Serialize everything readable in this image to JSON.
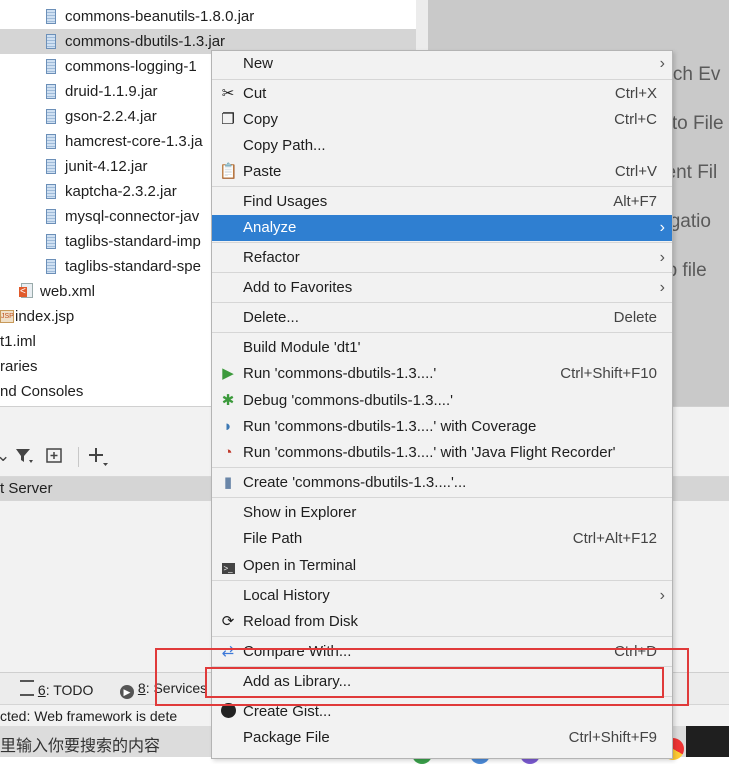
{
  "project_tree": {
    "items": [
      {
        "label": "commons-beanutils-1.8.0.jar",
        "type": "jar",
        "selected": false
      },
      {
        "label": "commons-dbutils-1.3.jar",
        "type": "jar",
        "selected": true
      },
      {
        "label": "commons-logging-1",
        "type": "jar",
        "selected": false
      },
      {
        "label": "druid-1.1.9.jar",
        "type": "jar",
        "selected": false
      },
      {
        "label": "gson-2.2.4.jar",
        "type": "jar",
        "selected": false
      },
      {
        "label": "hamcrest-core-1.3.ja",
        "type": "jar",
        "selected": false
      },
      {
        "label": "junit-4.12.jar",
        "type": "jar",
        "selected": false
      },
      {
        "label": "kaptcha-2.3.2.jar",
        "type": "jar",
        "selected": false
      },
      {
        "label": "mysql-connector-jav",
        "type": "jar",
        "selected": false
      },
      {
        "label": "taglibs-standard-imp",
        "type": "jar",
        "selected": false
      },
      {
        "label": "taglibs-standard-spe",
        "type": "jar",
        "selected": false
      },
      {
        "label": "web.xml",
        "type": "xml",
        "selected": false
      },
      {
        "label": "index.jsp",
        "type": "jsp",
        "selected": false
      },
      {
        "label": "t1.iml",
        "type": "iml",
        "selected": false
      },
      {
        "label": "raries",
        "type": "folder",
        "selected": false
      },
      {
        "label": "nd Consoles",
        "type": "folder",
        "selected": false
      }
    ]
  },
  "editor_hints": [
    "arch Ev",
    "o to File",
    "cent Fil",
    "vigatio",
    "op file"
  ],
  "services": {
    "server_row": "t Server"
  },
  "tool_tabs": {
    "todo_num": "6",
    "todo_label": ": TODO",
    "services_num": "8",
    "services_label": ": Services"
  },
  "statusbar": {
    "text": "cted: Web framework is dete"
  },
  "taskbar": {
    "search_placeholder": "里输入你要搜索的内容"
  },
  "context_menu": {
    "items": [
      {
        "label": "New",
        "shortcut": "",
        "submenu": true,
        "icon": ""
      },
      {
        "label": "Cut",
        "shortcut": "Ctrl+X",
        "submenu": false,
        "icon": "scissors-icon"
      },
      {
        "label": "Copy",
        "shortcut": "Ctrl+C",
        "submenu": false,
        "icon": "copy-icon"
      },
      {
        "label": "Copy Path...",
        "shortcut": "",
        "submenu": false,
        "icon": ""
      },
      {
        "label": "Paste",
        "shortcut": "Ctrl+V",
        "submenu": false,
        "icon": "paste-icon"
      },
      {
        "label": "Find Usages",
        "shortcut": "Alt+F7",
        "submenu": false,
        "icon": ""
      },
      {
        "label": "Analyze",
        "shortcut": "",
        "submenu": true,
        "icon": "",
        "highlighted": true
      },
      {
        "label": "Refactor",
        "shortcut": "",
        "submenu": true,
        "icon": ""
      },
      {
        "label": "Add to Favorites",
        "shortcut": "",
        "submenu": true,
        "icon": ""
      },
      {
        "label": "Delete...",
        "shortcut": "Delete",
        "submenu": false,
        "icon": ""
      },
      {
        "label": "Build Module 'dt1'",
        "shortcut": "",
        "submenu": false,
        "icon": ""
      },
      {
        "label": "Run 'commons-dbutils-1.3....'",
        "shortcut": "Ctrl+Shift+F10",
        "submenu": false,
        "icon": "run-icon"
      },
      {
        "label": "Debug 'commons-dbutils-1.3....'",
        "shortcut": "",
        "submenu": false,
        "icon": "debug-icon"
      },
      {
        "label": "Run 'commons-dbutils-1.3....' with Coverage",
        "shortcut": "",
        "submenu": false,
        "icon": "coverage-icon"
      },
      {
        "label": "Run 'commons-dbutils-1.3....' with 'Java Flight Recorder'",
        "shortcut": "",
        "submenu": false,
        "icon": "profiler-icon"
      },
      {
        "label": "Create 'commons-dbutils-1.3....'...",
        "shortcut": "",
        "submenu": false,
        "icon": "config-icon"
      },
      {
        "label": "Show in Explorer",
        "shortcut": "",
        "submenu": false,
        "icon": ""
      },
      {
        "label": "File Path",
        "shortcut": "Ctrl+Alt+F12",
        "submenu": false,
        "icon": ""
      },
      {
        "label": "Open in Terminal",
        "shortcut": "",
        "submenu": false,
        "icon": "terminal-icon"
      },
      {
        "label": "Local History",
        "shortcut": "",
        "submenu": true,
        "icon": ""
      },
      {
        "label": "Reload from Disk",
        "shortcut": "",
        "submenu": false,
        "icon": "reload-icon"
      },
      {
        "label": "Compare With...",
        "shortcut": "Ctrl+D",
        "submenu": false,
        "icon": "compare-icon"
      },
      {
        "label": "Add as Library...",
        "shortcut": "",
        "submenu": false,
        "icon": ""
      },
      {
        "label": "Create Gist...",
        "shortcut": "",
        "submenu": false,
        "icon": "github-icon"
      },
      {
        "label": "Package File",
        "shortcut": "Ctrl+Shift+F9",
        "submenu": false,
        "icon": ""
      }
    ]
  },
  "colors": {
    "menu_highlight": "#2f7fd1",
    "annotation_red": "#e03a3a",
    "selection_gray": "#d5d5d5"
  }
}
